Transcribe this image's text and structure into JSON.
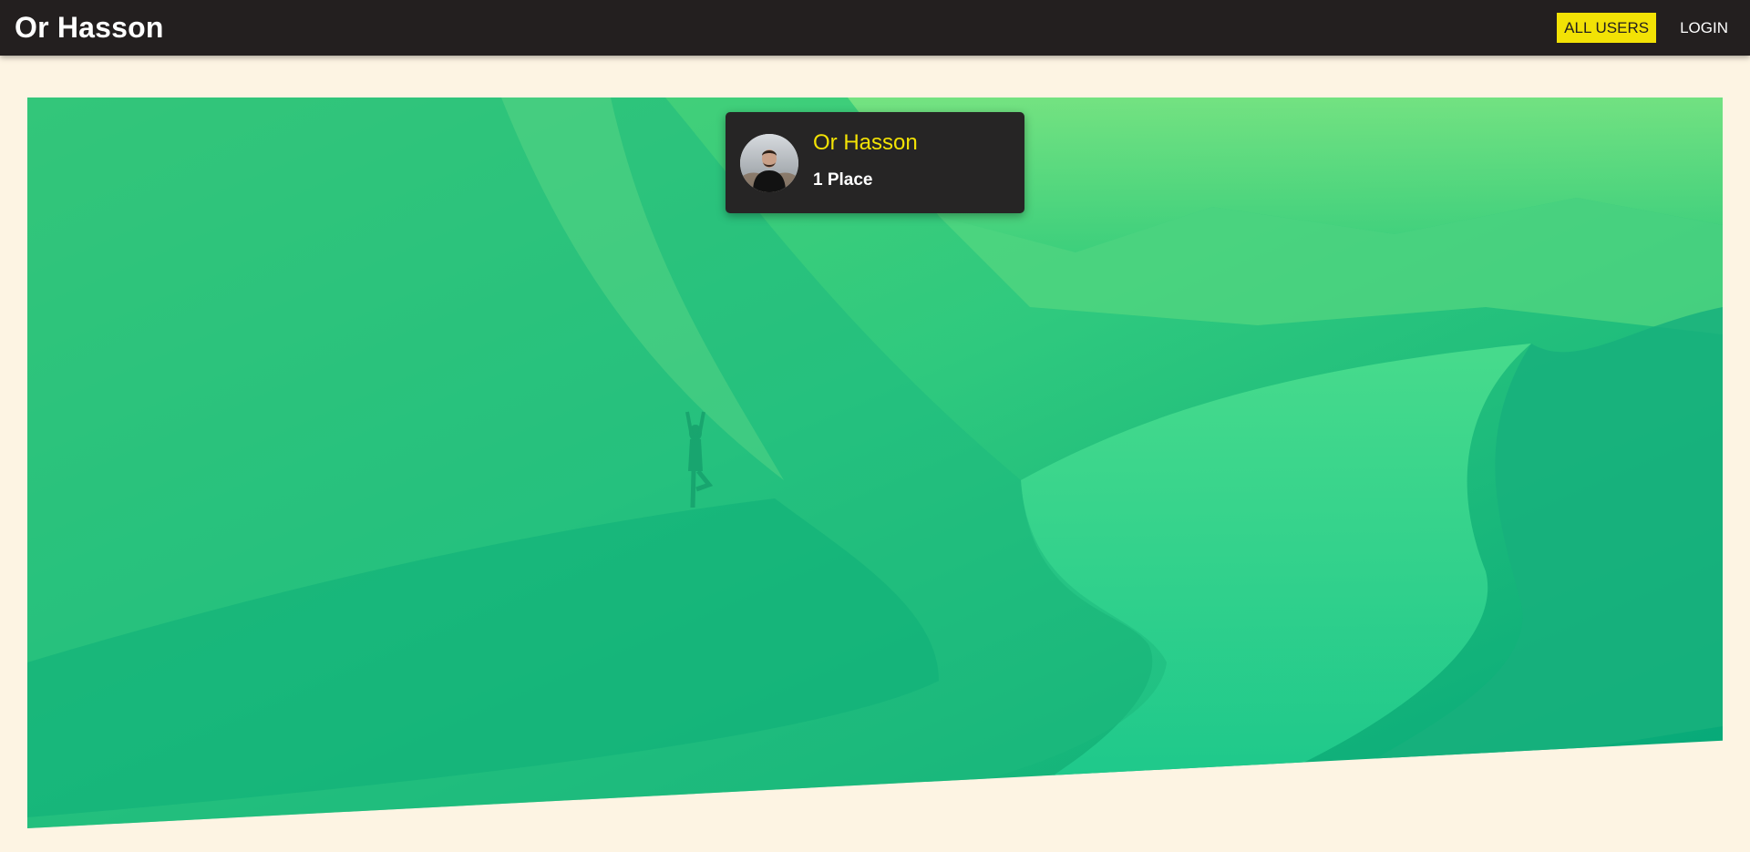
{
  "header": {
    "brand": "Or Hasson",
    "nav": [
      {
        "label": "ALL USERS",
        "active": true
      },
      {
        "label": "LOGIN",
        "active": false
      }
    ]
  },
  "hero": {
    "image": "green-tinted-fjord-landscape",
    "tint_colors": [
      "#7ee682",
      "#0fb883",
      "#03a678"
    ]
  },
  "place_card": {
    "avatar": "user-avatar",
    "name": "Or Hasson",
    "places_text": "1 Place"
  },
  "colors": {
    "page_background": "#fdf4e3",
    "header_background": "#231f1f",
    "accent": "#f2e205",
    "card_background": "#262525"
  }
}
